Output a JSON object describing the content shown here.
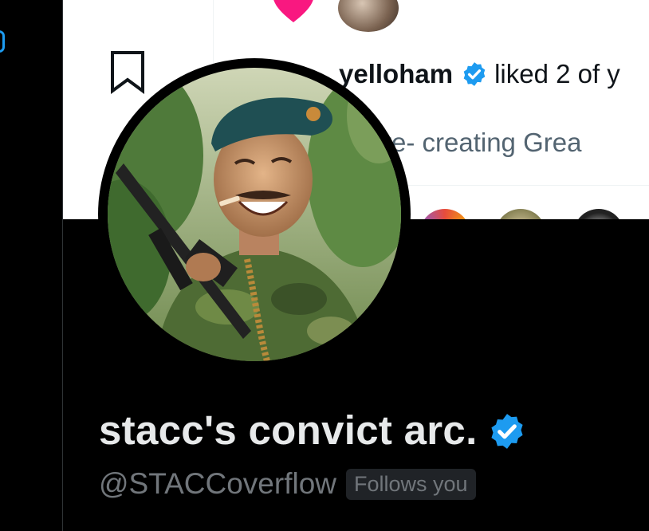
{
  "banner": {
    "notification": {
      "name": "yelloham",
      "action": "liked 2 of y",
      "quote": "y -are- creating Grea"
    },
    "icons": [
      "heart-icon",
      "bookmark-icon",
      "verified-badge-icon"
    ]
  },
  "profile": {
    "display_name": "stacc's convict arc.",
    "handle": "@STACCoverflow",
    "follows_you": "Follows you",
    "verified": true
  },
  "colors": {
    "background": "#000000",
    "verified_blue": "#1d9bf0",
    "name_text": "#e7e9ea",
    "secondary_text": "#71767b",
    "heart_pink": "#f91880"
  }
}
